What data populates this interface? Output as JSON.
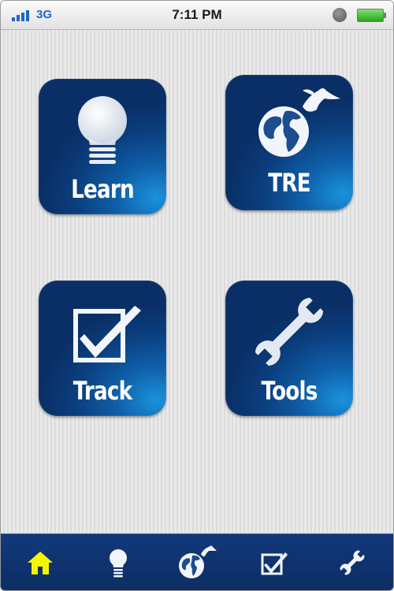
{
  "status_bar": {
    "network": "3G",
    "time": "7:11 PM"
  },
  "tiles": {
    "learn": {
      "label": "Learn",
      "icon": "lightbulb-icon"
    },
    "tre": {
      "label": "TRE",
      "icon": "globe-eagle-icon"
    },
    "track": {
      "label": "Track",
      "icon": "checkbox-icon"
    },
    "tools": {
      "label": "Tools",
      "icon": "wrench-icon"
    }
  },
  "tab_bar": {
    "items": [
      {
        "icon": "home-icon",
        "active": true
      },
      {
        "icon": "lightbulb-icon",
        "active": false
      },
      {
        "icon": "globe-eagle-icon",
        "active": false
      },
      {
        "icon": "checkbox-icon",
        "active": false
      },
      {
        "icon": "wrench-icon",
        "active": false
      }
    ]
  },
  "colors": {
    "tile_dark": "#0a2f66",
    "tile_light": "#1a92dc",
    "tab_bar": "#12397a",
    "tab_active": "#f5f500",
    "battery": "#2da11f",
    "network": "#1d67c4"
  }
}
